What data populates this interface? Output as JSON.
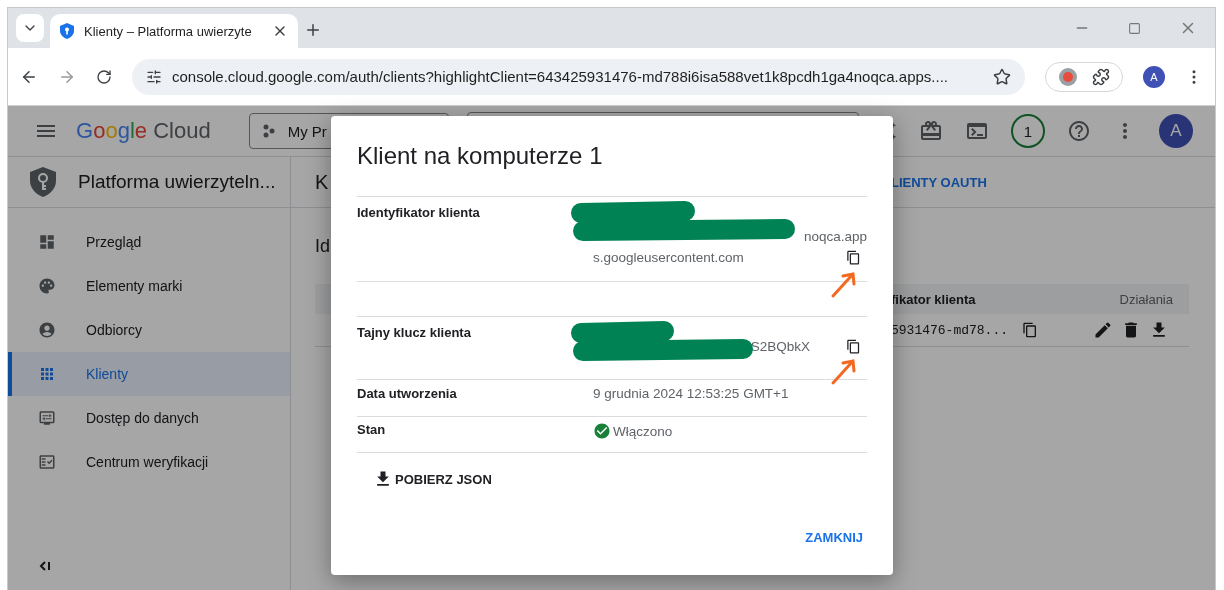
{
  "browser": {
    "tab": {
      "title": "Klienty – Platforma uwierzyte"
    },
    "url": "console.cloud.google.com/auth/clients?highlightClient=643425931476-md788i6isa588vet1k8pcdh1ga4noqca.apps....",
    "profile_initial": "A"
  },
  "header": {
    "logo": [
      "Google",
      "Cloud"
    ],
    "project": "My Pr",
    "notifications": "1",
    "avatar": "A"
  },
  "sidebar": {
    "title": "Platforma uwierzyteln...",
    "items": [
      {
        "label": "Przegląd",
        "selected": false
      },
      {
        "label": "Elementy marki",
        "selected": false
      },
      {
        "label": "Odbiorcy",
        "selected": false
      },
      {
        "label": "Klienty",
        "selected": true
      },
      {
        "label": "Dostęp do danych",
        "selected": false
      },
      {
        "label": "Centrum weryfikacji",
        "selected": false
      }
    ]
  },
  "main": {
    "title": "K",
    "link": "LIENTY OAUTH",
    "section": "Id",
    "table": {
      "columns": [
        "fikator klienta",
        "Działania"
      ],
      "rows": [
        {
          "client_id": "5931476-md78..."
        }
      ]
    }
  },
  "dialog": {
    "title": "Klient na komputerze 1",
    "rows": [
      {
        "kind": "secret",
        "label": "Identyfikator klienta",
        "lines": [
          "noqca.app",
          "s.googleusercontent.com"
        ],
        "copyable": true,
        "redacted": true
      },
      {
        "kind": "secret",
        "label": "Tajny klucz klienta",
        "lines": [
          "S2BQbkX"
        ],
        "copyable": true,
        "redacted": true
      },
      {
        "kind": "text",
        "label": "Data utworzenia",
        "value": "9 grudnia 2024 12:53:25 GMT+1"
      },
      {
        "kind": "status",
        "label": "Stan",
        "value": "Włączono"
      }
    ],
    "download": "POBIERZ JSON",
    "close": "ZAMKNIJ"
  }
}
